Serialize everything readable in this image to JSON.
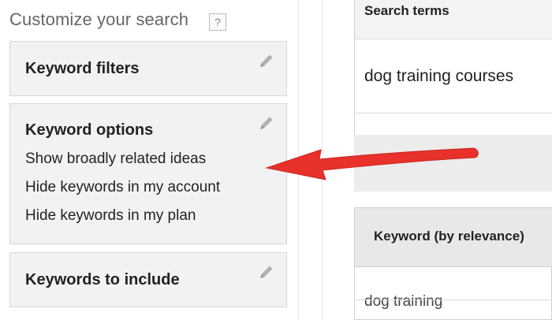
{
  "left_panel": {
    "title": "Customize your search",
    "help": "?",
    "cards": [
      {
        "title": "Keyword filters"
      },
      {
        "title": "Keyword options",
        "items": [
          "Show broadly related ideas",
          "Hide keywords in my account",
          "Hide keywords in my plan"
        ]
      },
      {
        "title": "Keywords to include"
      }
    ]
  },
  "right_panel": {
    "search": {
      "header": "Search terms",
      "term": "dog training courses"
    },
    "results": {
      "header": "Keyword (by relevance)",
      "first_row": "dog training"
    }
  },
  "colors": {
    "arrow": "#e8312b",
    "card_bg": "#f2f2f2",
    "pencil": "#aaaaaa"
  },
  "icons": {
    "edit": "pencil-icon",
    "help": "question-icon",
    "annotation": "red-arrow"
  }
}
